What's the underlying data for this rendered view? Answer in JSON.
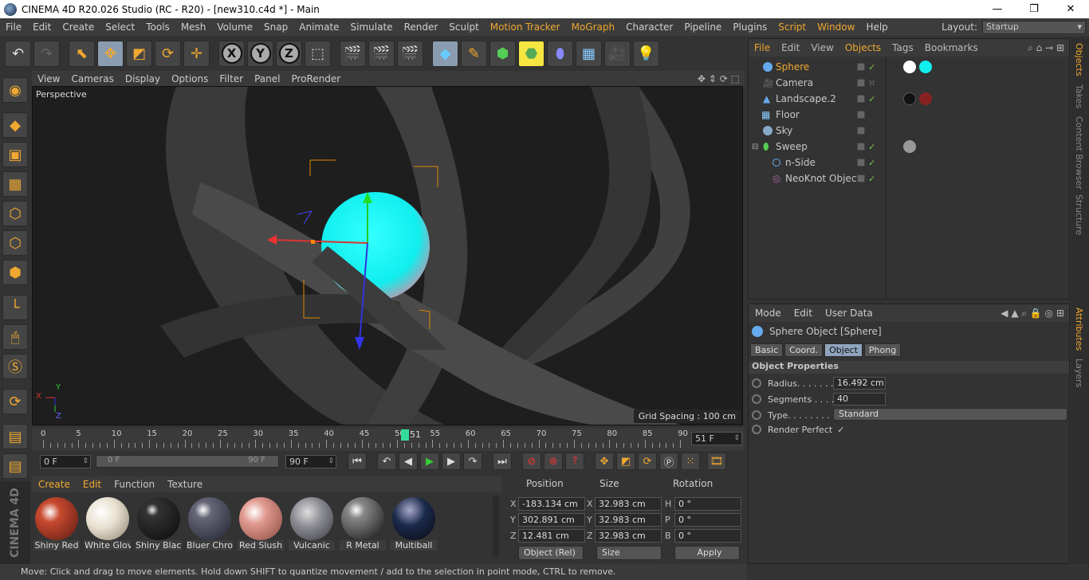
{
  "window": {
    "title": "CINEMA 4D R20.026 Studio (RC - R20) - [new310.c4d *] - Main"
  },
  "menu": [
    {
      "label": "File"
    },
    {
      "label": "Edit"
    },
    {
      "label": "Create"
    },
    {
      "label": "Select"
    },
    {
      "label": "Tools"
    },
    {
      "label": "Mesh"
    },
    {
      "label": "Volume"
    },
    {
      "label": "Snap"
    },
    {
      "label": "Animate"
    },
    {
      "label": "Simulate"
    },
    {
      "label": "Render"
    },
    {
      "label": "Sculpt"
    },
    {
      "label": "Motion Tracker"
    },
    {
      "label": "MoGraph"
    },
    {
      "label": "Character"
    },
    {
      "label": "Pipeline"
    },
    {
      "label": "Plugins"
    },
    {
      "label": "Script"
    },
    {
      "label": "Window"
    },
    {
      "label": "Help"
    }
  ],
  "layout": {
    "label": "Layout:",
    "value": "Startup"
  },
  "viewport": {
    "menu": [
      "View",
      "Cameras",
      "Display",
      "Options",
      "Filter",
      "Panel",
      "ProRender"
    ],
    "label": "Perspective",
    "grid_spacing": "Grid Spacing : 100 cm",
    "axes": {
      "x": "X",
      "y": "Y",
      "z": "Z"
    }
  },
  "timeline": {
    "ticks": [
      "0",
      "5",
      "10",
      "15",
      "20",
      "25",
      "30",
      "35",
      "40",
      "45",
      "50",
      "55",
      "60",
      "65",
      "70",
      "75",
      "80",
      "85",
      "90"
    ],
    "current": "51",
    "current_field": "51 F",
    "start": "0 F",
    "range_start": "0 F",
    "range_end": "90 F",
    "end": "90 F"
  },
  "materials": {
    "menu": [
      "Create",
      "Edit",
      "Function",
      "Texture"
    ],
    "items": [
      {
        "name": "Shiny Red",
        "color": "#c84a30"
      },
      {
        "name": "White Glov",
        "color": "#e8e0d0"
      },
      {
        "name": "Shiny Black",
        "color": "#1a1a1a"
      },
      {
        "name": "Bluer Chro",
        "color": "#404854"
      },
      {
        "name": "Red Slush",
        "color": "#e09a90"
      },
      {
        "name": "Vulcanic",
        "color": "#8a8a92"
      },
      {
        "name": "R Metal",
        "color": "#707070"
      },
      {
        "name": "Multiball",
        "color": "#1a2a4a"
      }
    ]
  },
  "coordinates": {
    "headers": {
      "position": "Position",
      "size": "Size",
      "rotation": "Rotation"
    },
    "rows": [
      {
        "axis": "X",
        "pos": "-183.134 cm",
        "saxis": "X",
        "size": "32.983 cm",
        "raxis": "H",
        "rot": "0 °"
      },
      {
        "axis": "Y",
        "pos": "302.891 cm",
        "saxis": "Y",
        "size": "32.983 cm",
        "raxis": "P",
        "rot": "0 °"
      },
      {
        "axis": "Z",
        "pos": "12.481 cm",
        "saxis": "Z",
        "size": "32.983 cm",
        "raxis": "B",
        "rot": "0 °"
      }
    ],
    "mode": "Object (Rel)",
    "size_mode": "Size",
    "apply": "Apply"
  },
  "status": "Move: Click and drag to move elements. Hold down SHIFT to quantize movement / add to the selection in point mode, CTRL to remove.",
  "objects": {
    "menu": [
      {
        "label": "File",
        "hl": true
      },
      {
        "label": "Edit"
      },
      {
        "label": "View"
      },
      {
        "label": "Objects",
        "hl": true
      },
      {
        "label": "Tags"
      },
      {
        "label": "Bookmarks"
      }
    ],
    "items": [
      {
        "name": "Sphere",
        "selected": true
      },
      {
        "name": "Camera"
      },
      {
        "name": "Landscape.2"
      },
      {
        "name": "Floor"
      },
      {
        "name": "Sky"
      },
      {
        "name": "Sweep"
      },
      {
        "name": "n-Side"
      },
      {
        "name": "NeoKnot Object"
      }
    ]
  },
  "attributes": {
    "menu": [
      "Mode",
      "Edit",
      "User Data"
    ],
    "object_title": "Sphere Object [Sphere]",
    "tabs": [
      {
        "label": "Basic"
      },
      {
        "label": "Coord."
      },
      {
        "label": "Object",
        "active": true
      },
      {
        "label": "Phong"
      }
    ],
    "section": "Object Properties",
    "props": [
      {
        "label": "Radius. . . . . . .",
        "value": "16.492 cm"
      },
      {
        "label": "Segments . . . .",
        "value": "40"
      },
      {
        "label": "Type. . . . . . . . .",
        "value": "Standard"
      },
      {
        "label": "Render Perfect",
        "value": "✓"
      }
    ]
  },
  "right_tabs": [
    "Objects",
    "Takes",
    "Content Browser",
    "Structure",
    "Attributes",
    "Layers"
  ],
  "brand": "CINEMA 4D"
}
